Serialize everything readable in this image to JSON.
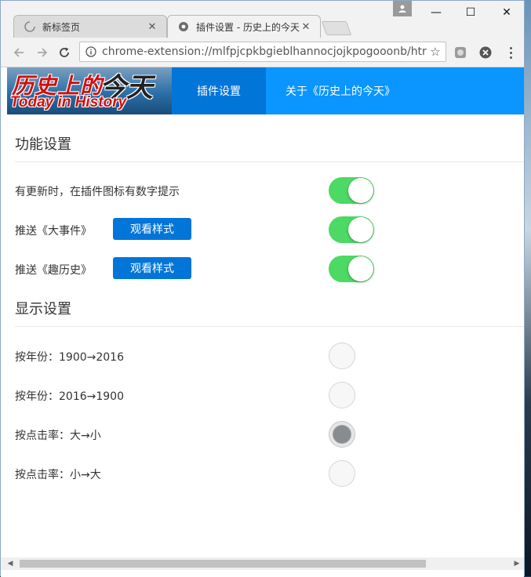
{
  "browser": {
    "tabs": [
      {
        "title": "新标签页",
        "active": false,
        "icon": "loading-spinner-icon"
      },
      {
        "title": "插件设置 - 历史上的今天",
        "active": true,
        "icon": "extension-gear-icon"
      }
    ],
    "tab_close_glyph": "✕",
    "address_bar": {
      "url": "chrome-extension://mlfpjcpkbgieblhannocjojkpogooonb/htr"
    },
    "window_controls": {
      "minimize": "—",
      "maximize": "☐",
      "close": "✕"
    }
  },
  "header": {
    "logo": {
      "cn_part1": "历史上的",
      "cn_part2": "今天",
      "en": "Today in History"
    },
    "nav": [
      {
        "label": "插件设置",
        "active": true
      },
      {
        "label": "关于《历史上的今天》",
        "active": false
      }
    ]
  },
  "sections": {
    "function": {
      "title": "功能设置",
      "rows": [
        {
          "label": "有更新时，在插件图标有数字提示",
          "enabled": true
        },
        {
          "label": "推送《大事件》",
          "button": "观看样式",
          "enabled": true
        },
        {
          "label": "推送《趣历史》",
          "button": "观看样式",
          "enabled": true
        }
      ]
    },
    "display": {
      "title": "显示设置",
      "options": [
        {
          "label": "按年份：1900→2016",
          "selected": false
        },
        {
          "label": "按年份：2016→1900",
          "selected": false
        },
        {
          "label": "按点击率：大→小",
          "selected": true
        },
        {
          "label": "按点击率：小→大",
          "selected": false
        }
      ]
    }
  },
  "colors": {
    "nav_bg": "#0a95ff",
    "nav_active_bg": "#0275d8",
    "button_bg": "#0275d8",
    "toggle_on": "#4cd964"
  }
}
